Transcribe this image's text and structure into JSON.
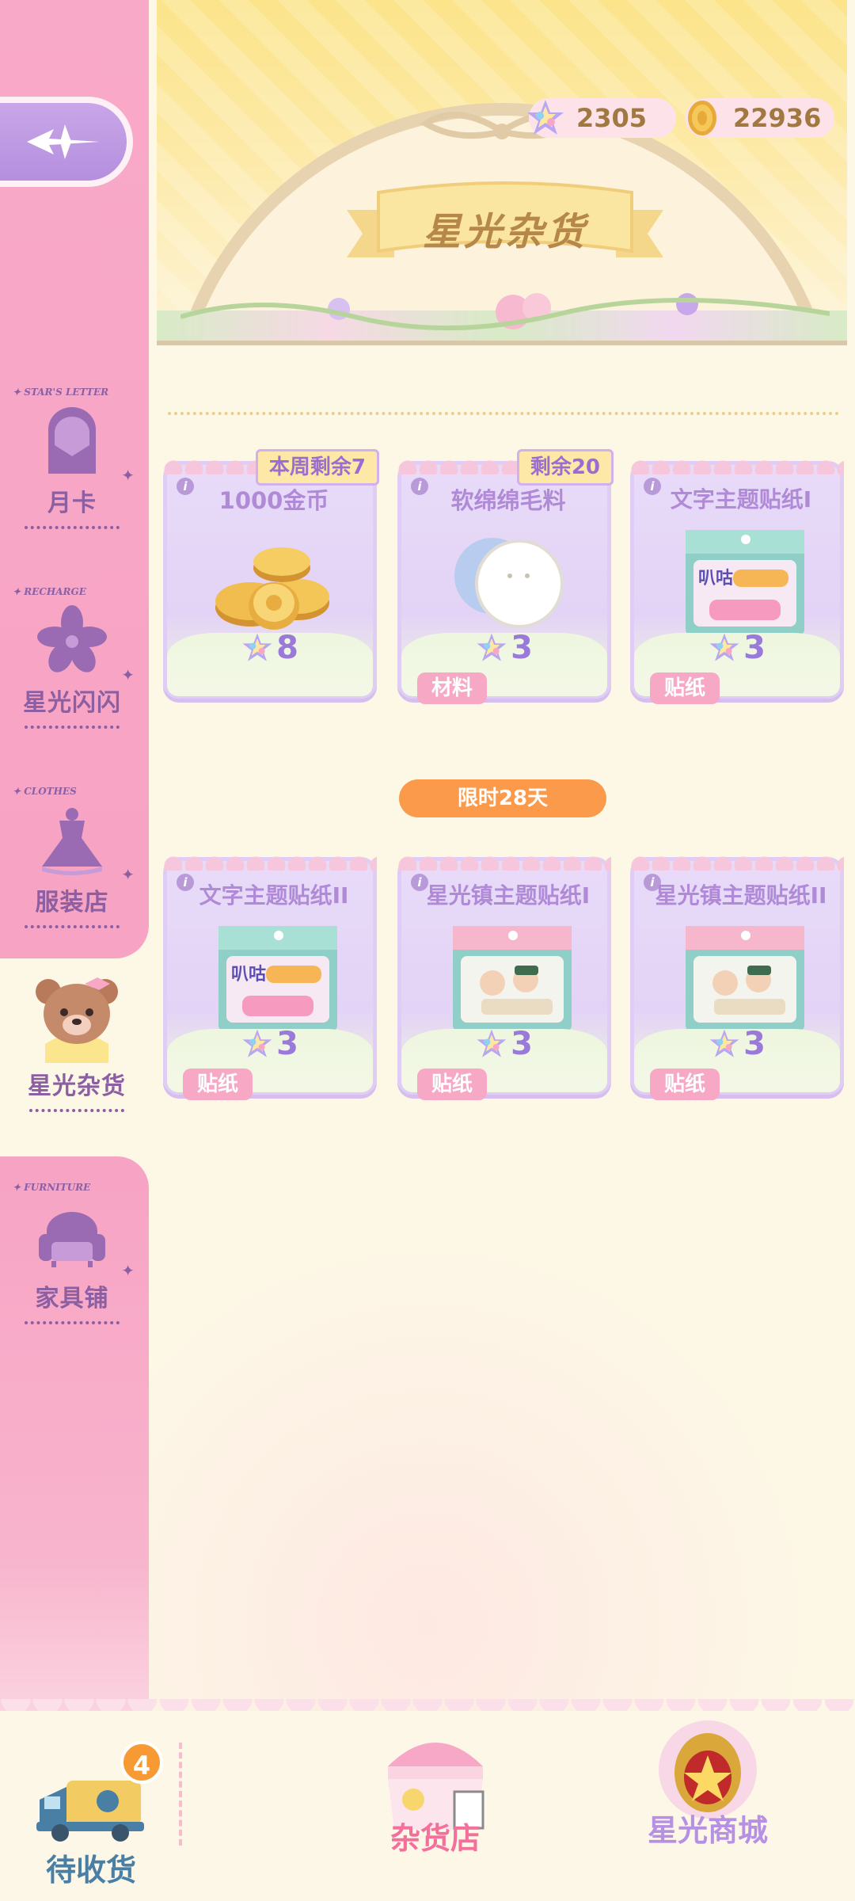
{
  "header": {
    "title": "星光杂货",
    "currencies": [
      {
        "icon": "star-crystal-icon",
        "value": "2305"
      },
      {
        "icon": "gold-coin-icon",
        "value": "22936"
      }
    ]
  },
  "sidebar": {
    "items": [
      {
        "tag": "STAR'S LETTER",
        "label": "月卡",
        "icon": "letter-icon"
      },
      {
        "tag": "RECHARGE",
        "label": "星光闪闪",
        "icon": "flower-icon"
      },
      {
        "tag": "CLOTHES",
        "label": "服装店",
        "icon": "dress-icon"
      },
      {
        "tag": "",
        "label": "星光杂货",
        "icon": "bear-icon"
      },
      {
        "tag": "FURNITURE",
        "label": "家具铺",
        "icon": "sofa-icon"
      }
    ]
  },
  "products": [
    {
      "title": "1000金币",
      "price": "8",
      "limit": "本周剩余7",
      "tag": "",
      "image": "coin-pile-image"
    },
    {
      "title": "软绵绵毛料",
      "price": "3",
      "limit": "剩余20",
      "tag": "材料",
      "image": "fluffy-material-image"
    },
    {
      "title": "文字主题贴纸I",
      "price": "3",
      "limit": "",
      "tag": "贴纸",
      "image": "text-sticker-image"
    },
    {
      "title": "文字主题贴纸II",
      "price": "3",
      "limit": "",
      "tag": "贴纸",
      "image": "text-sticker-image"
    },
    {
      "title": "星光镇主题贴纸I",
      "price": "3",
      "limit": "",
      "tag": "贴纸",
      "image": "town-sticker-image"
    },
    {
      "title": "星光镇主题贴纸II",
      "price": "3",
      "limit": "",
      "tag": "贴纸",
      "image": "town-sticker-image"
    }
  ],
  "limited_time": "限时28天",
  "bottom_nav": {
    "pending": {
      "label": "待收货",
      "badge": "4"
    },
    "grocery": {
      "label": "杂货店"
    },
    "mall": {
      "label": "星光商城"
    }
  },
  "colors": {
    "sidebar_pink": "#f7a3c4",
    "accent_purple": "#8c5fa3",
    "price_purple": "#9a7ad8",
    "limited_orange": "#fb9a4a",
    "banner_yellow": "#fbe48a"
  }
}
